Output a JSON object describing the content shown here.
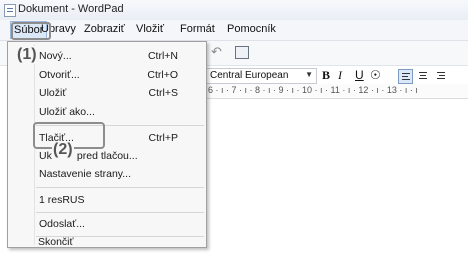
{
  "window": {
    "title": "Dokument - WordPad"
  },
  "menubar": {
    "items": [
      "Súbor",
      "Úpravy",
      "Zobraziť",
      "Vložiť",
      "Formát",
      "Pomocník"
    ]
  },
  "toolbar": {
    "font": "Central European",
    "bold": "B",
    "italic": "I",
    "underline": "U"
  },
  "ruler": {
    "text": "6 · ı · 7 · ı · 8 · ı · 9 · ı · 10 · ı · 11 · ı · 12 · ı · 13 · ı · ı"
  },
  "file_menu": {
    "items": [
      {
        "label": "Nový...",
        "shortcut": "Ctrl+N"
      },
      {
        "label": "Otvoriť...",
        "shortcut": "Ctrl+O"
      },
      {
        "label": "Uložiť",
        "shortcut": "Ctrl+S"
      },
      {
        "label": "Uložiť ako...",
        "shortcut": ""
      },
      {
        "label": "Tlačiť...",
        "shortcut": "Ctrl+P"
      },
      {
        "label": "Ukážka pred tlačou...",
        "shortcut": ""
      },
      {
        "label": "Nastavenie strany...",
        "shortcut": ""
      },
      {
        "label": "1 resRUS",
        "shortcut": ""
      },
      {
        "label": "Odoslať...",
        "shortcut": ""
      },
      {
        "label": "Skončiť",
        "shortcut": ""
      }
    ]
  },
  "callouts": {
    "first": "(1)",
    "second": "(2)"
  },
  "colors": {
    "highlight": "#dbe8f7",
    "callout": "#8d8d8d"
  }
}
